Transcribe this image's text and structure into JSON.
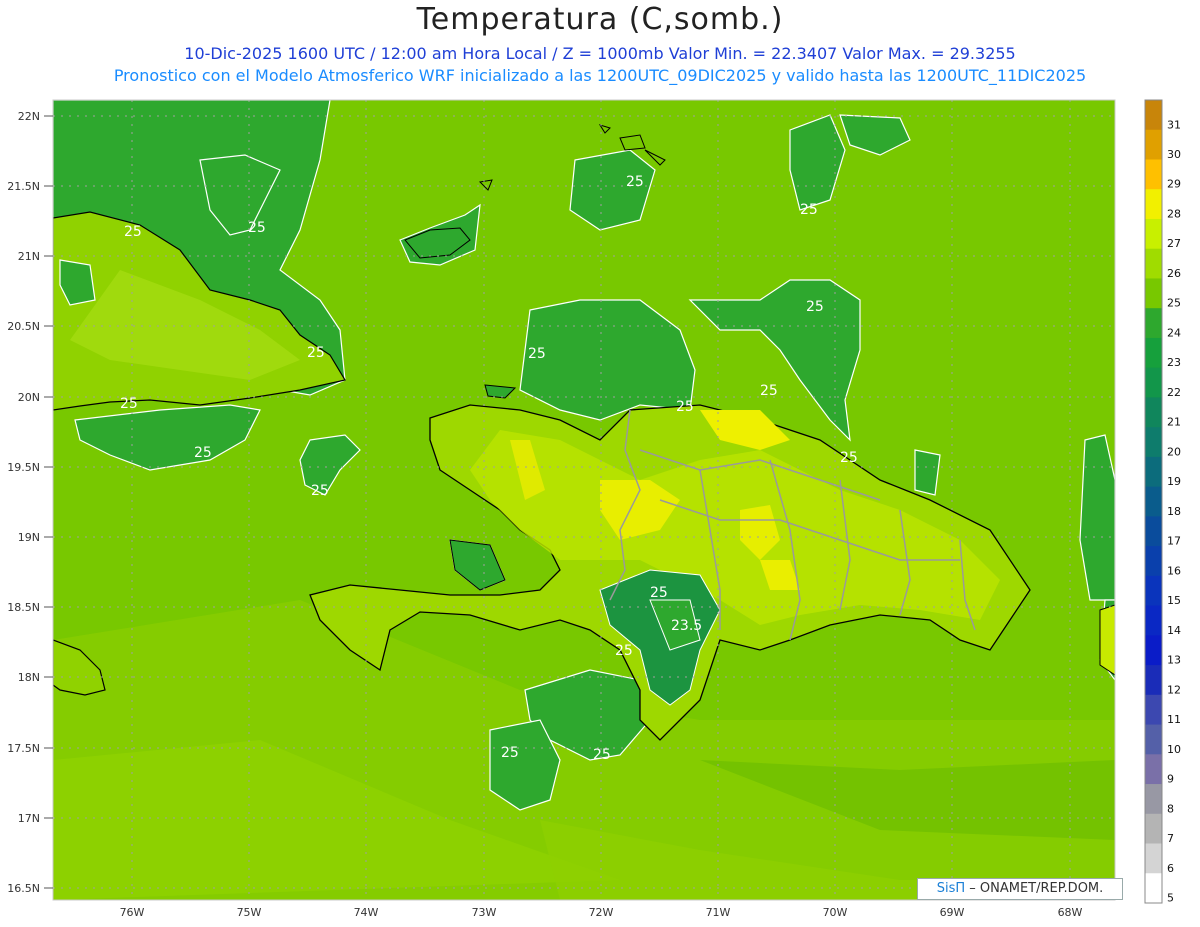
{
  "title": "Temperatura (C,somb.)",
  "subtitle1": "10-Dic-2025 1600 UTC / 12:00 am Hora Local / Z = 1000mb   Valor Min. = 22.3407   Valor Max. = 29.3255",
  "subtitle2": "Pronostico con el Modelo Atmosferico WRF inicializado a las 1200UTC_09DIC2025 y valido hasta las  1200UTC_11DIC2025",
  "credit": {
    "logo": "SisΠ",
    "text": " – ONAMET/REP.DOM."
  },
  "lat_labels": [
    "22N",
    "21.5N",
    "21N",
    "20.5N",
    "20N",
    "19.5N",
    "19N",
    "18.5N",
    "18N",
    "17.5N",
    "17N",
    "16.5N"
  ],
  "lon_labels": [
    "76W",
    "75W",
    "74W",
    "73W",
    "72W",
    "71W",
    "70W",
    "69W",
    "68W"
  ],
  "contour_labels": [
    "25",
    "25",
    "25",
    "25",
    "25",
    "25",
    "25",
    "25",
    "25",
    "25",
    "25",
    "25",
    "25",
    "25",
    "25",
    "23.5",
    "25",
    "25"
  ],
  "colorbar": {
    "labels": [
      "31",
      "30",
      "29",
      "28",
      "27",
      "26",
      "25",
      "24",
      "23",
      "22",
      "21",
      "20",
      "19",
      "18",
      "17",
      "16",
      "15",
      "14",
      "13",
      "12",
      "11",
      "10",
      "9",
      "8",
      "7",
      "6",
      "5"
    ],
    "colors": [
      "#c8850a",
      "#e0a000",
      "#ffc000",
      "#f2f000",
      "#c8f000",
      "#a0dc00",
      "#78c800",
      "#2ea82e",
      "#16a03c",
      "#12964a",
      "#10865c",
      "#0e7c6c",
      "#0c6c7c",
      "#0a5c8c",
      "#0a4c9c",
      "#0a40ac",
      "#0a34bc",
      "#0a28c4",
      "#0a1cc8",
      "#1a2cb8",
      "#3c48b0",
      "#5460a8",
      "#7a70a8",
      "#9898a4",
      "#b4b4b4",
      "#d4d4d4",
      "#ffffff"
    ]
  },
  "colors": {
    "ocean": "#7fc400",
    "coast": "#5aa800",
    "land": "#92d400",
    "warm": "#c8ea00",
    "hot": "#eef000",
    "cool": "#2aa22a",
    "cold": "#1c9440"
  }
}
